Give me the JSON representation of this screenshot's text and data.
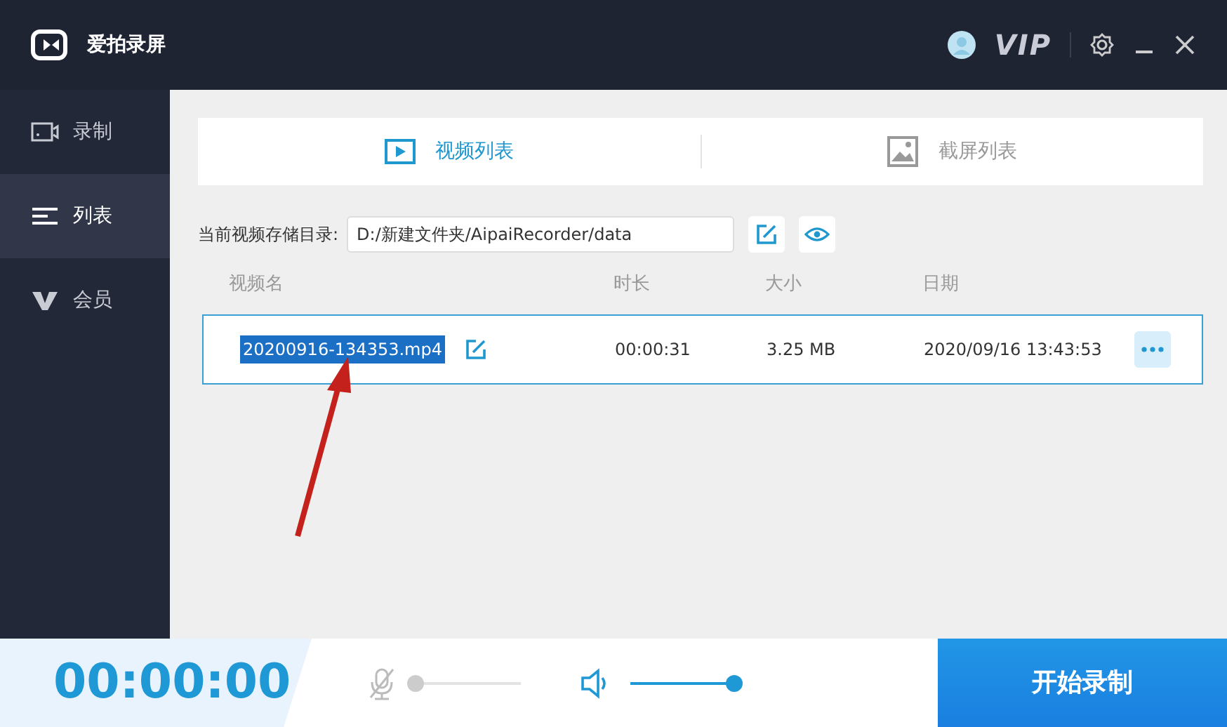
{
  "app": {
    "title": "爱拍录屏",
    "vip": "VIP"
  },
  "sidebar": {
    "items": [
      {
        "label": "录制",
        "kind": "record",
        "selected": false
      },
      {
        "label": "列表",
        "kind": "list",
        "selected": true
      },
      {
        "label": "会员",
        "kind": "member",
        "selected": false
      }
    ]
  },
  "tabs": [
    {
      "label": "视频列表",
      "kind": "video",
      "selected": true
    },
    {
      "label": "截屏列表",
      "kind": "screenshot",
      "selected": false
    }
  ],
  "directory": {
    "label": "当前视频存储目录:",
    "value": "D:/新建文件夹/AipaiRecorder/data"
  },
  "table": {
    "columns": [
      "视频名",
      "时长",
      "大小",
      "日期"
    ],
    "rows": [
      {
        "name": "20200916-134353.mp4",
        "name_selected": true,
        "duration": "00:00:31",
        "size": "3.25 MB",
        "date": "2020/09/16 13:43:53",
        "selected": true
      }
    ]
  },
  "bottom_bar": {
    "timer": "00:00:00",
    "microphone": {
      "muted": true,
      "level": 0
    },
    "speaker": {
      "muted": false,
      "level": 1
    },
    "start_button": "开始录制"
  }
}
